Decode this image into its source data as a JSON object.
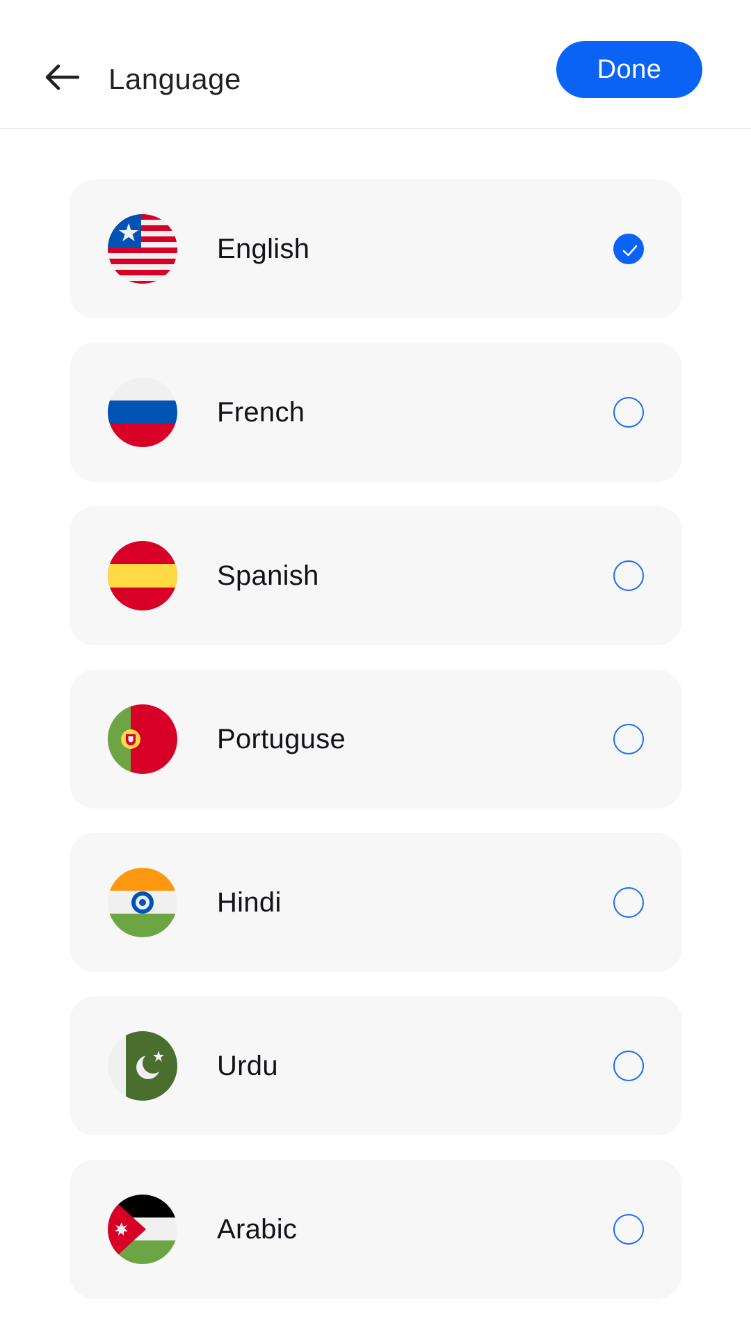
{
  "header": {
    "back_icon": "arrow-left-icon",
    "title": "Language",
    "done_label": "Done"
  },
  "colors": {
    "accent": "#0a63f5",
    "card_bg": "#f7f7f8",
    "text": "#121217"
  },
  "languages": [
    {
      "label": "English",
      "flag": "us-flag-icon",
      "selected": true
    },
    {
      "label": "French",
      "flag": "russia-flag-icon",
      "selected": false
    },
    {
      "label": "Spanish",
      "flag": "spain-flag-icon",
      "selected": false
    },
    {
      "label": "Portuguse",
      "flag": "portugal-flag-icon",
      "selected": false
    },
    {
      "label": "Hindi",
      "flag": "india-flag-icon",
      "selected": false
    },
    {
      "label": "Urdu",
      "flag": "pakistan-flag-icon",
      "selected": false
    },
    {
      "label": "Arabic",
      "flag": "jordan-flag-icon",
      "selected": false
    }
  ]
}
